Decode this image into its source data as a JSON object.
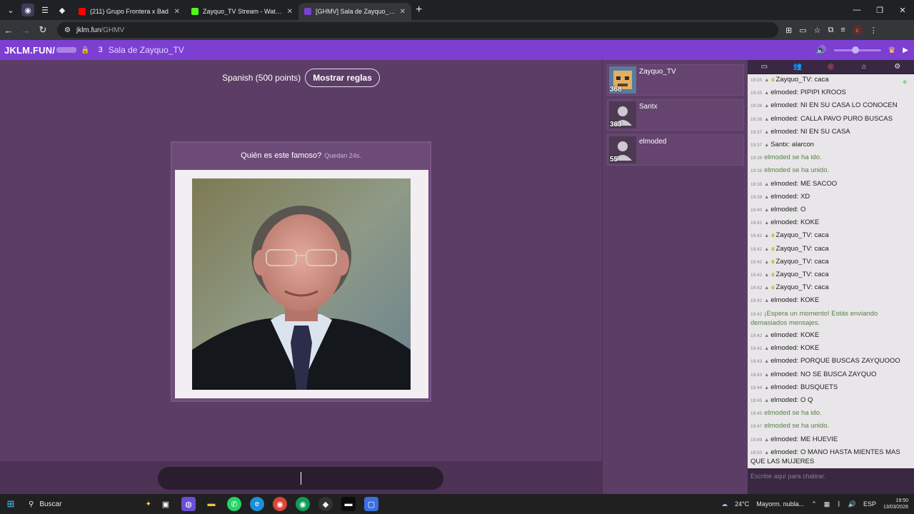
{
  "browser": {
    "tabs": [
      {
        "title": "(211) Grupo Frontera x Bad",
        "favicon_color": "#ff0000",
        "active": false
      },
      {
        "title": "Zayquo_TV Stream - Watch Live",
        "favicon_color": "#53fc18",
        "active": false
      },
      {
        "title": "[GHMV] Sala de Zayquo_TV",
        "favicon_color": "#7c3fd1",
        "active": true
      }
    ],
    "new_tab": "+",
    "address": {
      "domain": "jklm.fun",
      "path": "/GHMV"
    }
  },
  "app": {
    "logo": "JKLM.FUN/",
    "room_count": "3",
    "room_name": "Sala de Zayquo_TV",
    "accent": "#7c3fd1",
    "volume_fraction": 0.45
  },
  "game": {
    "dictionary_label": "Spanish (500 points)",
    "rules_button": "Mostrar reglas",
    "question": "Quién es este famoso?",
    "timer": "Quedan 24s."
  },
  "players": [
    {
      "name": "Zayquo_TV",
      "score": "368",
      "avatar": "custom"
    },
    {
      "name": "Santx",
      "score": "363",
      "avatar": "default"
    },
    {
      "name": "elmoded",
      "score": "55",
      "avatar": "default"
    }
  ],
  "chat": {
    "tabs": [
      "chat-icon",
      "players-icon",
      "settings-dot-icon",
      "home-icon",
      "gear-icon"
    ],
    "messages": [
      {
        "time": "19:35",
        "user": "Zayquo_TV",
        "crown": true,
        "text": "caca"
      },
      {
        "time": "19:35",
        "user": "elmoded",
        "crown": false,
        "text": "PIPIPI KROOS"
      },
      {
        "time": "19:36",
        "user": "elmoded",
        "crown": false,
        "text": "NI EN SU CASA LO CONOCEN"
      },
      {
        "time": "19:36",
        "user": "elmoded",
        "crown": false,
        "text": "CALLA PAVO PURO BUSCAS"
      },
      {
        "time": "19:37",
        "user": "elmoded",
        "crown": false,
        "text": "NI EN SU CASA"
      },
      {
        "time": "19:37",
        "user": "Santx",
        "crown": false,
        "text": "alarcon"
      },
      {
        "time": "19:38",
        "system": true,
        "text": "elmoded se ha ido."
      },
      {
        "time": "19:38",
        "system": true,
        "text": "elmoded se ha unido."
      },
      {
        "time": "19:38",
        "user": "elmoded",
        "crown": false,
        "text": "ME SACOO"
      },
      {
        "time": "19:38",
        "user": "elmoded",
        "crown": false,
        "text": "XD"
      },
      {
        "time": "19:40",
        "user": "elmoded",
        "crown": false,
        "text": "O"
      },
      {
        "time": "19:42",
        "user": "elmoded",
        "crown": false,
        "text": "KOKE"
      },
      {
        "time": "19:42",
        "user": "Zayquo_TV",
        "crown": true,
        "text": "caca"
      },
      {
        "time": "19:42",
        "user": "Zayquo_TV",
        "crown": true,
        "text": "caca"
      },
      {
        "time": "19:42",
        "user": "Zayquo_TV",
        "crown": true,
        "text": "caca"
      },
      {
        "time": "19:42",
        "user": "Zayquo_TV",
        "crown": true,
        "text": "caca"
      },
      {
        "time": "19:42",
        "user": "Zayquo_TV",
        "crown": true,
        "text": "caca"
      },
      {
        "time": "19:42",
        "user": "elmoded",
        "crown": false,
        "text": "KOKE"
      },
      {
        "time": "19:42",
        "system": true,
        "text": "¡Espera un momento! Estás enviando demasiados mensajes."
      },
      {
        "time": "19:42",
        "user": "elmoded",
        "crown": false,
        "text": "KOKE"
      },
      {
        "time": "19:42",
        "user": "elmoded",
        "crown": false,
        "text": "KOKE"
      },
      {
        "time": "19:43",
        "user": "elmoded",
        "crown": false,
        "text": "PORQUE BUSCAS ZAYQUOOO"
      },
      {
        "time": "19:43",
        "user": "elmoded",
        "crown": false,
        "text": "NO SE BUSCA ZAYQUO"
      },
      {
        "time": "19:44",
        "user": "elmoded",
        "crown": false,
        "text": "BUSQUETS"
      },
      {
        "time": "19:45",
        "user": "elmoded",
        "crown": false,
        "text": "O Q"
      },
      {
        "time": "19:45",
        "system": true,
        "text": "elmoded se ha ido."
      },
      {
        "time": "19:47",
        "system": true,
        "text": "elmoded se ha unido."
      },
      {
        "time": "19:49",
        "user": "elmoded",
        "crown": false,
        "text": "ME HUEVIE"
      },
      {
        "time": "19:50",
        "user": "elmoded",
        "crown": false,
        "text": "O MANO HASTA MIENTES MAS QUE LAS MUJERES"
      }
    ],
    "input_placeholder": "Escribe aquí para chatear."
  },
  "taskbar": {
    "search_label": "Buscar",
    "weather": "24°C",
    "weather_text": "Mayorm. nubla...",
    "language": "ESP",
    "time": "19:50",
    "date": "13/03/2026"
  }
}
